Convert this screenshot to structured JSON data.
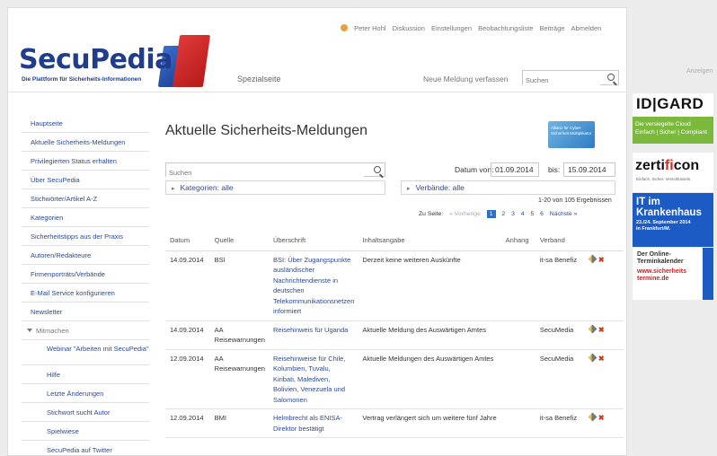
{
  "header": {
    "logo_text": "SecuPedia",
    "logo_tagline": "Die Plattform für Sicherheits-Informationen",
    "page_type": "Spezialseite",
    "user_nav": [
      "Peter Hohl",
      "Diskussion",
      "Einstellungen",
      "Beobachtungsliste",
      "Beiträge",
      "Abmelden"
    ],
    "new_report": "Neue Meldung verfassen",
    "search_placeholder": "Suchen"
  },
  "sidebar": {
    "items": [
      "Hauptseite",
      "Aktuelle Sicherheits-Meldungen",
      "Privilegierten Status erhalten",
      "Über SecuPedia",
      "Stichwörter/Artikel A-Z",
      "Kategorien",
      "Sicherheitstipps aus der Praxis",
      "Autoren/Redakteure",
      "Firmenporträts/Verbände",
      "E-Mail Service konfigurieren",
      "Newsletter"
    ],
    "section": "Mitmachen",
    "sub_items": [
      "Webinar \"Arbeiten mit SecuPedia\"",
      "Hilfe",
      "Letzte Änderungen",
      "Stichwort sucht Autor",
      "Spielwiese",
      "SecuPedia auf Twitter"
    ]
  },
  "main": {
    "title": "Aktuelle Sicherheits-Meldungen",
    "badge_text": "Allianz für Cyber-Sicherheit Multiplikator",
    "search_placeholder": "Suchen",
    "date_from_label": "Datum von:",
    "date_from": "01.09.2014",
    "date_to_label": "bis:",
    "date_to": "15.09.2014",
    "categories_filter": "Kategorien: alle",
    "associations_filter": "Verbände: alle",
    "results": "1-20 von 105 Ergebnissen",
    "pager": {
      "label": "Zu Seite:",
      "prev": "« Vorherige",
      "pages": [
        "1",
        "2",
        "3",
        "4",
        "5",
        "6"
      ],
      "next": "Nächste »"
    },
    "columns": [
      "Datum",
      "Quelle",
      "Überschrift",
      "Inhaltsangabe",
      "Anhang",
      "Verband"
    ],
    "rows": [
      {
        "date": "14.09.2014",
        "source": "BSI",
        "headline": "BSI: Über Zugangspunkte ausländischer Nachrichtendienste in deutschen Telekommunikationsnetzen informiert",
        "summary": "Derzeit keine weiteren Auskünfte",
        "attachment": "",
        "association": "it-sa Benefiz"
      },
      {
        "date": "14.09.2014",
        "source": "AA Reisewarnungen",
        "headline": "Reisehinweis für Uganda",
        "summary": "Aktuelle Meldung des Auswärtigen Amtes",
        "attachment": "",
        "association": "SecuMedia"
      },
      {
        "date": "12.09.2014",
        "source": "AA Reisewarnungen",
        "headline": "Reisehinweise für Chile, Kolumbien, Tuvalu, Kiribati, Malediven, Bolivien, Venezuela und Salomonen",
        "summary": "Aktuelle Meldungen des Auswärtigen Amtes",
        "attachment": "",
        "association": "SecuMedia"
      },
      {
        "date": "12.09.2014",
        "source": "BMI",
        "headline": "Helmbrecht als ENISA-Direktor bestätigt",
        "summary": "Vertrag verlängert sich um weitere fünf Jahre",
        "attachment": "",
        "association": "it-sa Benefiz"
      }
    ]
  },
  "ads": {
    "label": "Anzeigen",
    "idgard": {
      "brand": "ID|GARD",
      "line1": "Die versiegelte Cloud",
      "line2": "Einfach | Sicher | Compliant"
    },
    "zertificon": {
      "brand_a": "zerti",
      "brand_b": "fi",
      "brand_c": "con",
      "slogan": "Einfach. Sicher. Verschlüsseln."
    },
    "krankenhaus": {
      "headline": "IT im Krankenhaus",
      "date": "23./24. September 2014",
      "place": "in Frankfurt/M."
    },
    "termine": {
      "line1": "Der Online-",
      "line2": "Terminkalender",
      "url1": "www.sicherheits",
      "url2": "termine.de"
    }
  },
  "colors": {
    "link": "#2d4a93",
    "accent_blue": "#1d5bc4",
    "pager_active": "#2d6fc8"
  }
}
